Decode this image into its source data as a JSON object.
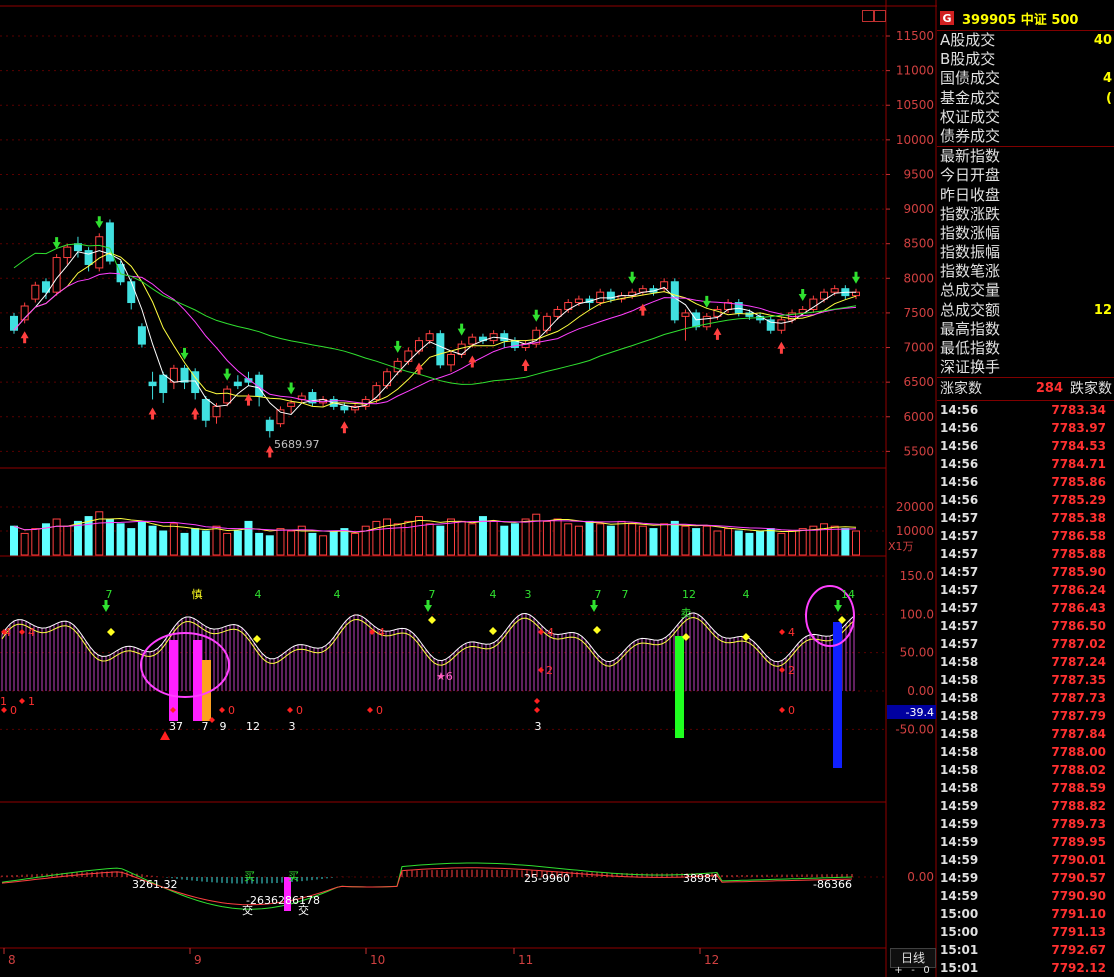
{
  "header": {
    "g_badge": "G",
    "code_title": "399905 中证 500"
  },
  "quote_rows": [
    {
      "label": "A股成交",
      "value": "40"
    },
    {
      "label": "B股成交",
      "value": ""
    },
    {
      "label": "国债成交",
      "value": "4"
    },
    {
      "label": "基金成交",
      "value": "("
    },
    {
      "label": "权证成交",
      "value": ""
    },
    {
      "label": "债券成交",
      "value": ""
    }
  ],
  "index_rows": [
    {
      "label": "最新指数",
      "value": ""
    },
    {
      "label": "今日开盘",
      "value": ""
    },
    {
      "label": "昨日收盘",
      "value": ""
    },
    {
      "label": "指数涨跌",
      "value": ""
    },
    {
      "label": "指数涨幅",
      "value": ""
    },
    {
      "label": "指数振幅",
      "value": ""
    },
    {
      "label": "指数笔涨",
      "value": ""
    },
    {
      "label": "总成交量",
      "value": ""
    },
    {
      "label": "总成交额",
      "value": "12"
    },
    {
      "label": "最高指数",
      "value": ""
    },
    {
      "label": "最低指数",
      "value": ""
    },
    {
      "label": "深证换手",
      "value": ""
    }
  ],
  "advance": {
    "up_label": "涨家数",
    "up_count": "284",
    "down_label": "跌家数"
  },
  "ticks": [
    [
      "14:56",
      "7783.34"
    ],
    [
      "14:56",
      "7783.97"
    ],
    [
      "14:56",
      "7784.53"
    ],
    [
      "14:56",
      "7784.71"
    ],
    [
      "14:56",
      "7785.86"
    ],
    [
      "14:56",
      "7785.29"
    ],
    [
      "14:57",
      "7785.38"
    ],
    [
      "14:57",
      "7786.58"
    ],
    [
      "14:57",
      "7785.88"
    ],
    [
      "14:57",
      "7785.90"
    ],
    [
      "14:57",
      "7786.24"
    ],
    [
      "14:57",
      "7786.43"
    ],
    [
      "14:57",
      "7786.50"
    ],
    [
      "14:57",
      "7787.02"
    ],
    [
      "14:58",
      "7787.24"
    ],
    [
      "14:58",
      "7787.35"
    ],
    [
      "14:58",
      "7787.73"
    ],
    [
      "14:58",
      "7787.79"
    ],
    [
      "14:58",
      "7787.84"
    ],
    [
      "14:58",
      "7788.00"
    ],
    [
      "14:58",
      "7788.02"
    ],
    [
      "14:58",
      "7788.59"
    ],
    [
      "14:59",
      "7788.82"
    ],
    [
      "14:59",
      "7789.73"
    ],
    [
      "14:59",
      "7789.95"
    ],
    [
      "14:59",
      "7790.01"
    ],
    [
      "14:59",
      "7790.57"
    ],
    [
      "14:59",
      "7790.90"
    ],
    [
      "15:00",
      "7791.10"
    ],
    [
      "15:00",
      "7791.13"
    ],
    [
      "15:01",
      "7792.67"
    ],
    [
      "15:01",
      "7792.12"
    ]
  ],
  "price_axis": [
    "11500",
    "11000",
    "10500",
    "10000",
    "9500",
    "9000",
    "8500",
    "8000",
    "7500",
    "7000",
    "6500",
    "6000",
    "5500"
  ],
  "volume_axis": [
    "20000",
    "10000"
  ],
  "volume_unit": "X1万",
  "ind_axis": [
    "150.0",
    "100.0",
    "50.00",
    "0.00",
    "-50.00"
  ],
  "ind_current": "-39.4",
  "macd_axis": "0.00",
  "month_labels": [
    "8",
    "9",
    "10",
    "11",
    "12"
  ],
  "low_label": "5689.97",
  "candles": [
    [
      7450,
      7250,
      7500,
      7200
    ],
    [
      7400,
      7600,
      7650,
      7350
    ],
    [
      7700,
      7900,
      7950,
      7650
    ],
    [
      7950,
      7800,
      8000,
      7700
    ],
    [
      7800,
      8300,
      8350,
      7750
    ],
    [
      8300,
      8450,
      8500,
      8200
    ],
    [
      8500,
      8400,
      8600,
      8300
    ],
    [
      8400,
      8200,
      8450,
      8100
    ],
    [
      8150,
      8600,
      8650,
      8100
    ],
    [
      8800,
      8250,
      8850,
      8200
    ],
    [
      8200,
      7950,
      8250,
      7900
    ],
    [
      7950,
      7650,
      8000,
      7550
    ],
    [
      7300,
      7050,
      7350,
      7000
    ],
    [
      6500,
      6450,
      6650,
      6250
    ],
    [
      6600,
      6350,
      6650,
      6200
    ],
    [
      6500,
      6700,
      6750,
      6400
    ],
    [
      6700,
      6500,
      6750,
      6400
    ],
    [
      6650,
      6350,
      6700,
      6250
    ],
    [
      6250,
      5950,
      6300,
      5850
    ],
    [
      6000,
      6150,
      6200,
      5900
    ],
    [
      6200,
      6400,
      6450,
      6150
    ],
    [
      6500,
      6450,
      6600,
      6400
    ],
    [
      6550,
      6500,
      6650,
      6450
    ],
    [
      6600,
      6300,
      6650,
      6150
    ],
    [
      5950,
      5800,
      6000,
      5700
    ],
    [
      5900,
      6100,
      6150,
      5850
    ],
    [
      6150,
      6200,
      6250,
      6050
    ],
    [
      6250,
      6300,
      6350,
      6200
    ],
    [
      6350,
      6200,
      6400,
      6150
    ],
    [
      6200,
      6250,
      6300,
      6150
    ],
    [
      6250,
      6150,
      6300,
      6100
    ],
    [
      6150,
      6100,
      6200,
      6050
    ],
    [
      6100,
      6150,
      6200,
      6050
    ],
    [
      6150,
      6250,
      6300,
      6100
    ],
    [
      6250,
      6450,
      6500,
      6200
    ],
    [
      6450,
      6650,
      6700,
      6400
    ],
    [
      6650,
      6800,
      6850,
      6600
    ],
    [
      6800,
      6950,
      7000,
      6750
    ],
    [
      6950,
      7100,
      7150,
      6900
    ],
    [
      7100,
      7200,
      7250,
      7050
    ],
    [
      7200,
      6750,
      7250,
      6700
    ],
    [
      6750,
      6900,
      6950,
      6650
    ],
    [
      6900,
      7050,
      7100,
      6850
    ],
    [
      7050,
      7150,
      7200,
      7000
    ],
    [
      7150,
      7100,
      7200,
      7050
    ],
    [
      7100,
      7200,
      7250,
      7050
    ],
    [
      7200,
      7100,
      7250,
      7000
    ],
    [
      7100,
      7000,
      7150,
      6950
    ],
    [
      7000,
      7050,
      7100,
      6950
    ],
    [
      7050,
      7250,
      7300,
      7000
    ],
    [
      7250,
      7450,
      7500,
      7200
    ],
    [
      7450,
      7550,
      7600,
      7400
    ],
    [
      7550,
      7650,
      7700,
      7500
    ],
    [
      7650,
      7700,
      7750,
      7600
    ],
    [
      7700,
      7650,
      7750,
      7550
    ],
    [
      7650,
      7800,
      7850,
      7600
    ],
    [
      7800,
      7700,
      7850,
      7650
    ],
    [
      7700,
      7750,
      7800,
      7650
    ],
    [
      7750,
      7800,
      7850,
      7700
    ],
    [
      7800,
      7850,
      7900,
      7750
    ],
    [
      7850,
      7800,
      7900,
      7750
    ],
    [
      7850,
      7950,
      8000,
      7800
    ],
    [
      7950,
      7400,
      8000,
      7350
    ],
    [
      7450,
      7500,
      7550,
      7100
    ],
    [
      7500,
      7300,
      7550,
      7250
    ],
    [
      7300,
      7450,
      7500,
      7250
    ],
    [
      7450,
      7550,
      7600,
      7400
    ],
    [
      7550,
      7650,
      7700,
      7500
    ],
    [
      7650,
      7500,
      7700,
      7450
    ],
    [
      7500,
      7450,
      7550,
      7400
    ],
    [
      7450,
      7400,
      7500,
      7350
    ],
    [
      7400,
      7250,
      7450,
      7200
    ],
    [
      7250,
      7400,
      7450,
      7200
    ],
    [
      7400,
      7500,
      7550,
      7350
    ],
    [
      7500,
      7550,
      7600,
      7450
    ],
    [
      7550,
      7700,
      7750,
      7500
    ],
    [
      7700,
      7800,
      7850,
      7650
    ],
    [
      7800,
      7850,
      7900,
      7750
    ],
    [
      7850,
      7750,
      7900,
      7700
    ],
    [
      7750,
      7800,
      7850,
      7700
    ]
  ],
  "volumes": [
    12000,
    9000,
    11000,
    13000,
    15000,
    12000,
    14000,
    16000,
    18000,
    15000,
    13000,
    11000,
    14000,
    12000,
    10000,
    13000,
    9000,
    11000,
    10000,
    12000,
    9000,
    10000,
    14000,
    9000,
    8000,
    11000,
    10000,
    12000,
    9000,
    8000,
    10000,
    11000,
    9000,
    12000,
    14000,
    15000,
    13000,
    14000,
    16000,
    13000,
    12000,
    15000,
    14000,
    13000,
    16000,
    14000,
    12000,
    13000,
    15000,
    17000,
    14000,
    15000,
    13000,
    12000,
    14000,
    13000,
    12000,
    14000,
    13000,
    12000,
    11000,
    13000,
    14000,
    12000,
    11000,
    12000,
    10000,
    11000,
    10000,
    9000,
    10000,
    11000,
    9000,
    10000,
    11000,
    12000,
    13000,
    12000,
    11000,
    10000
  ]
}
